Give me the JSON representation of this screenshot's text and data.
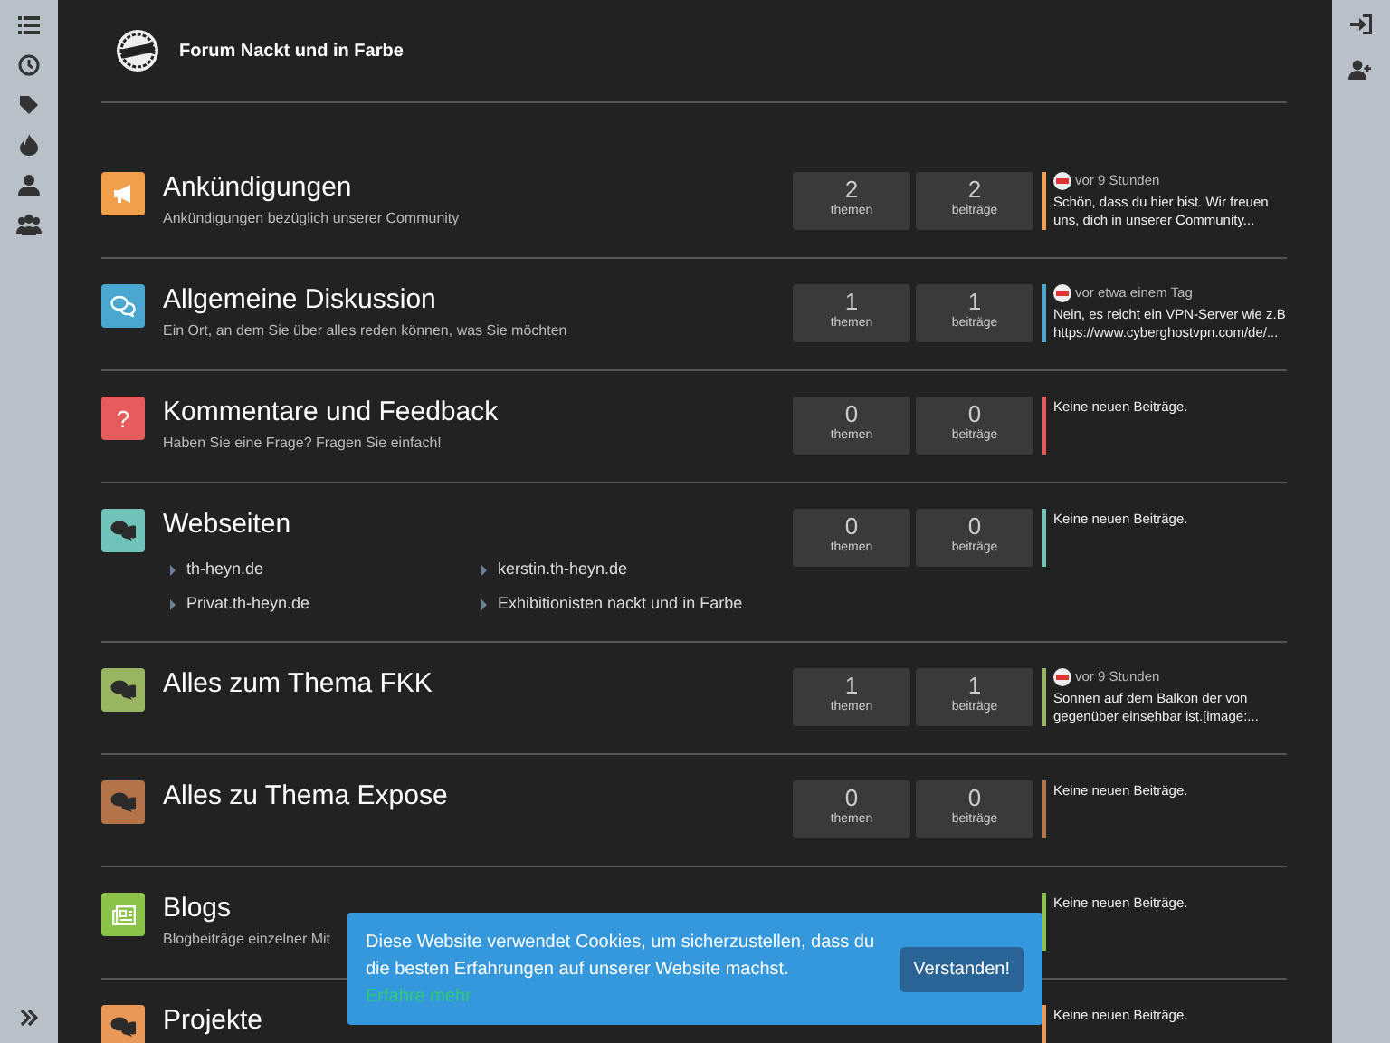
{
  "site": {
    "title": "Forum Nackt und in Farbe"
  },
  "categories": [
    {
      "title": "Ankündigungen",
      "description": "Ankündigungen bezüglich unserer Community",
      "kind": "megaphone",
      "color": "#f0a04b",
      "stats": [
        {
          "value": "2",
          "label": "themen"
        },
        {
          "value": "2",
          "label": "beiträge"
        }
      ],
      "last_post": {
        "time": "vor 9 Stunden",
        "text": "Schön, dass du hier bist. Wir freuen uns, dich in unserer Community..."
      }
    },
    {
      "title": "Allgemeine Diskussion",
      "description": "Ein Ort, an dem Sie über alles reden können, was Sie möchten",
      "kind": "chats",
      "color": "#4aa8d0",
      "stats": [
        {
          "value": "1",
          "label": "themen"
        },
        {
          "value": "1",
          "label": "beiträge"
        }
      ],
      "last_post": {
        "time": "vor etwa einem Tag",
        "text": "Nein, es reicht ein VPN-Server wie z.B https://www.cyberghostvpn.com/de/..."
      }
    },
    {
      "title": "Kommentare und Feedback",
      "description": "Haben Sie eine Frage? Fragen Sie einfach!",
      "kind": "glyph",
      "glyph": "?",
      "color": "#e55b5b",
      "stats": [
        {
          "value": "0",
          "label": "themen"
        },
        {
          "value": "0",
          "label": "beiträge"
        }
      ],
      "empty_text": "Keine neuen Beiträge."
    },
    {
      "title": "Webseiten",
      "kind": "chat",
      "color": "#6fc3b8",
      "subcategories": [
        "th-heyn.de",
        "kerstin.th-heyn.de",
        "Privat.th-heyn.de",
        "Exhibitionisten nackt und in Farbe"
      ],
      "stats": [
        {
          "value": "0",
          "label": "themen"
        },
        {
          "value": "0",
          "label": "beiträge"
        }
      ],
      "empty_text": "Keine neuen Beiträge."
    },
    {
      "title": "Alles zum Thema FKK",
      "kind": "chat",
      "color": "#9ab561",
      "stats": [
        {
          "value": "1",
          "label": "themen"
        },
        {
          "value": "1",
          "label": "beiträge"
        }
      ],
      "last_post": {
        "time": "vor 9 Stunden",
        "text": "Sonnen auf dem Balkon der von gegenüber einsehbar ist.[image:..."
      }
    },
    {
      "title": "Alles zu Thema Expose",
      "kind": "chat",
      "color": "#b5734a",
      "stats": [
        {
          "value": "0",
          "label": "themen"
        },
        {
          "value": "0",
          "label": "beiträge"
        }
      ],
      "empty_text": "Keine neuen Beiträge."
    },
    {
      "title": "Blogs",
      "description": "Blogbeiträge einzelner Mit",
      "kind": "newspaper",
      "color": "#8bc34a",
      "empty_text": "Keine neuen Beiträge."
    },
    {
      "title": "Projekte",
      "kind": "chat",
      "color": "#e8995a",
      "empty_text": "Keine neuen Beiträge."
    }
  ],
  "cookie_banner": {
    "text": "Diese Website verwendet Cookies, um sicherzustellen, dass du die besten Erfahrungen auf unserer Website machst.",
    "link": "Erfahre mehr",
    "button": "Verstanden!"
  }
}
